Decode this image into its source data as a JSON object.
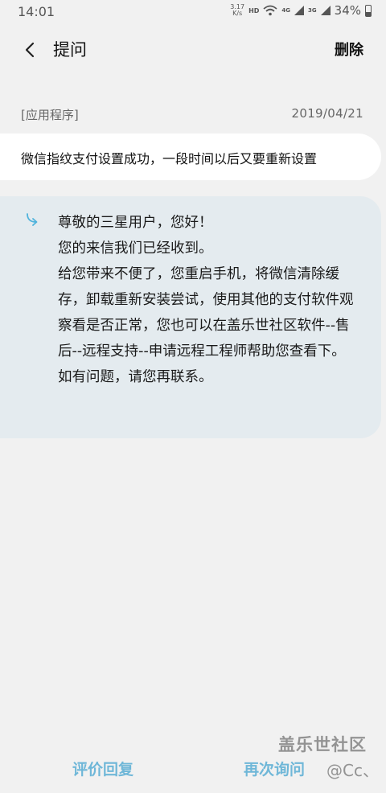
{
  "status_bar": {
    "time": "14:01",
    "speed_value": "3.17",
    "speed_unit": "K/s",
    "hd": "HD",
    "net1": "4G",
    "net2": "3G",
    "battery": "34%"
  },
  "header": {
    "title": "提问",
    "delete_label": "删除",
    "back_icon": "chevron-left-icon"
  },
  "meta": {
    "category": "[应用程序]",
    "date": "2019/04/21"
  },
  "question": {
    "text": "微信指纹支付设置成功，一段时间以后又要重新设置"
  },
  "answer": {
    "icon": "reply-arrow-icon",
    "text": "尊敬的三星用户，您好！\n您的来信我们已经收到。\n给您带来不便了，您重启手机，将微信清除缓存，卸载重新安装尝试，使用其他的支付软件观察看是否正常，您也可以在盖乐世社区软件--售后--远程支持--申请远程工程师帮助您查看下。\n如有问题，请您再联系。"
  },
  "actions": {
    "rate_label": "评价回复",
    "ask_again_label": "再次询问"
  },
  "watermark": {
    "line1": "盖乐世社区",
    "line2": "@Cc、"
  },
  "colors": {
    "accent": "#6fb7d8",
    "answer_bg": "#e4ebef",
    "page_bg": "#f1f1f1"
  }
}
